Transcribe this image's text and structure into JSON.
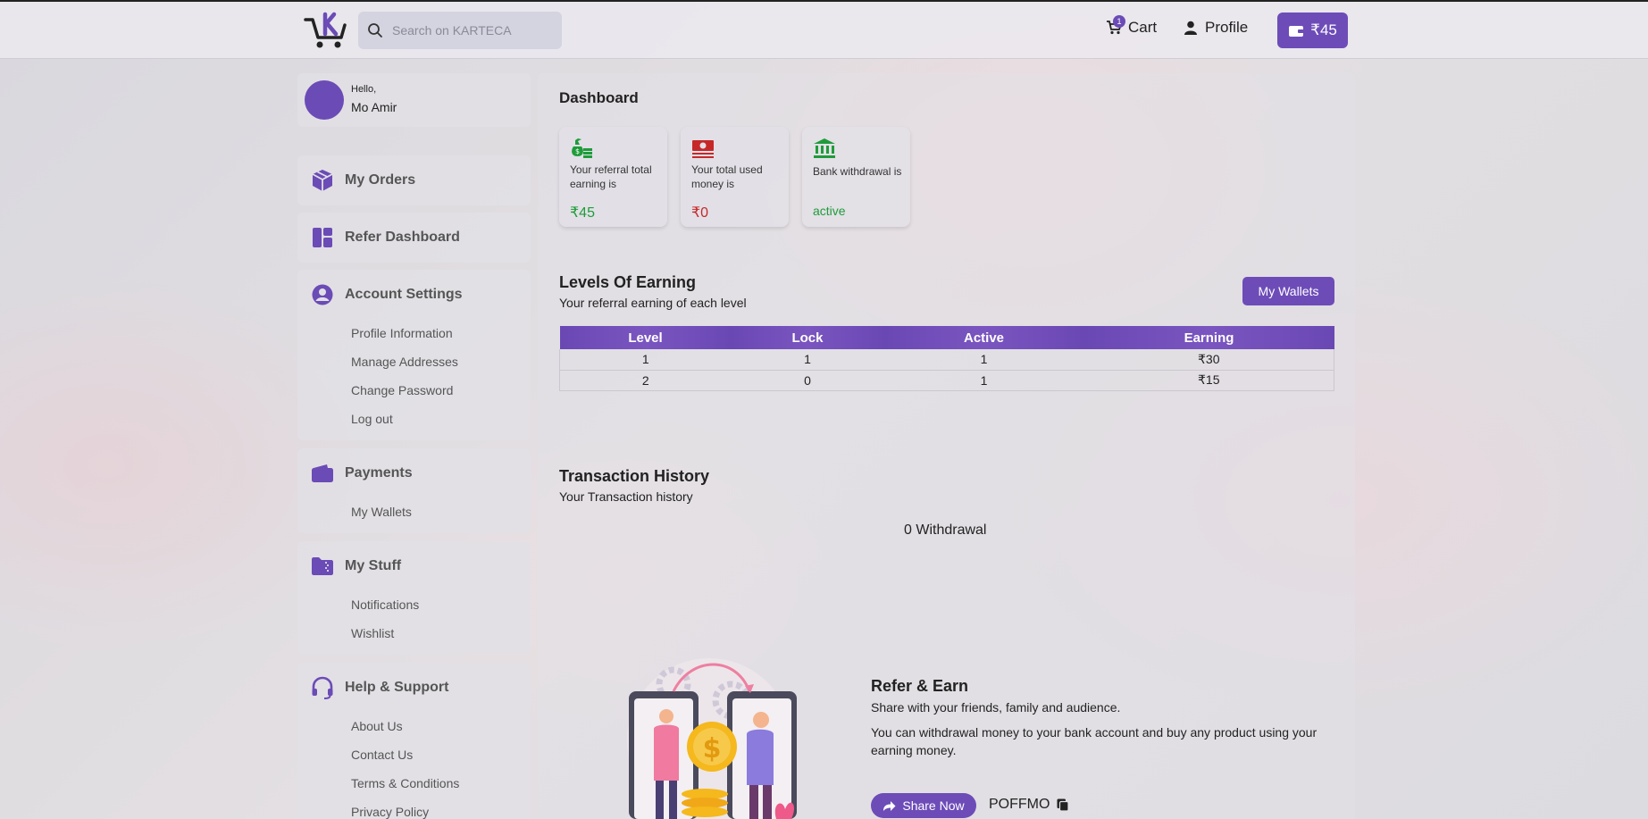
{
  "header": {
    "search_placeholder": "Search on KARTECA",
    "cart_label": "Cart",
    "cart_count": "1",
    "profile_label": "Profile",
    "wallet_amount": "₹45"
  },
  "sidebar": {
    "greeting": "Hello,",
    "user_name": "Mo Amir",
    "my_orders": "My Orders",
    "refer_dashboard": "Refer Dashboard",
    "account_settings": {
      "title": "Account Settings",
      "items": [
        "Profile Information",
        "Manage Addresses",
        "Change Password",
        "Log out"
      ]
    },
    "payments": {
      "title": "Payments",
      "items": [
        "My Wallets"
      ]
    },
    "my_stuff": {
      "title": "My Stuff",
      "items": [
        "Notifications",
        "Wishlist"
      ]
    },
    "help": {
      "title": "Help & Support",
      "items": [
        "About Us",
        "Contact Us",
        "Terms & Conditions",
        "Privacy Policy"
      ]
    }
  },
  "dashboard": {
    "title": "Dashboard",
    "stats": [
      {
        "text": "Your referral total earning is",
        "value": "₹45",
        "color": "#1e9c3a"
      },
      {
        "text": "Your total used money is",
        "value": "₹0",
        "color": "#c62828"
      },
      {
        "text": "Bank withdrawal is",
        "value": "active",
        "color": "#1e9c3a"
      }
    ]
  },
  "levels": {
    "title": "Levels Of Earning",
    "subtitle": "Your referral earning of each level",
    "button": "My Wallets",
    "columns": [
      "Level",
      "Lock",
      "Active",
      "Earning"
    ],
    "rows": [
      [
        "1",
        "1",
        "1",
        "₹30"
      ],
      [
        "2",
        "0",
        "1",
        "₹15"
      ]
    ]
  },
  "transactions": {
    "title": "Transaction History",
    "subtitle": "Your Transaction history",
    "withdrawal_count": "0 Withdrawal"
  },
  "refer": {
    "title": "Refer & Earn",
    "line1": "Share with your friends, family and audience.",
    "line2": "You can withdrawal money to your bank account and buy any product using your earning money.",
    "share_button": "Share Now",
    "code": "POFFMO"
  },
  "colors": {
    "accent": "#6d4cb8",
    "green": "#1e9c3a",
    "red": "#c62828"
  }
}
